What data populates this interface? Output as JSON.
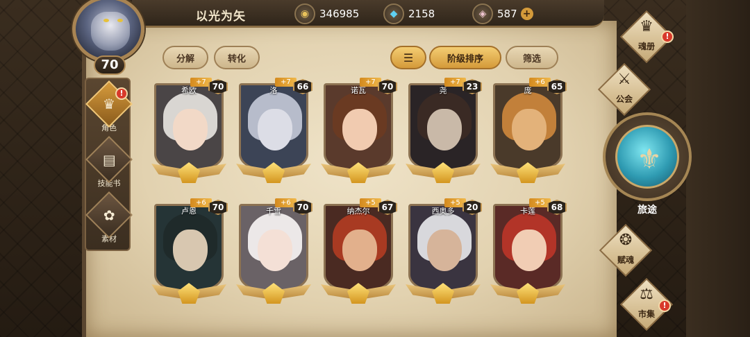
{
  "header": {
    "player_name": "以光为矢",
    "level": "70",
    "currencies": [
      {
        "icon": "gold-coin-icon",
        "value": "346985"
      },
      {
        "icon": "blue-crystal-icon",
        "value": "2158"
      },
      {
        "icon": "pink-gem-icon",
        "value": "587",
        "plus": "+"
      }
    ]
  },
  "side_tabs": [
    {
      "label": "角色",
      "icon": "helmet-icon",
      "active": true,
      "alert": "!"
    },
    {
      "label": "技能书",
      "icon": "book-icon",
      "active": false
    },
    {
      "label": "素材",
      "icon": "material-icon",
      "active": false
    }
  ],
  "actions": {
    "decompose": "分解",
    "convert": "转化",
    "sort_icon": "sort-icon",
    "rank_sort": "阶级排序",
    "filter": "筛选"
  },
  "heroes": [
    {
      "name": "希欧",
      "plus": "+7",
      "level": "70",
      "hair": "#d9d6d2",
      "skin": "#f2d9c7",
      "bg": "#4a4546"
    },
    {
      "name": "洛",
      "plus": "+7",
      "level": "66",
      "hair": "#b7bccb",
      "skin": "#dcdde6",
      "bg": "#3c4456"
    },
    {
      "name": "诺瓦",
      "plus": "+7",
      "level": "70",
      "hair": "#6a3a22",
      "skin": "#f1cbb0",
      "bg": "#5a3a2c"
    },
    {
      "name": "尧",
      "plus": "+7",
      "level": "23",
      "hair": "#3a2a24",
      "skin": "#c9b9a8",
      "bg": "#2a2426"
    },
    {
      "name": "庞",
      "plus": "+6",
      "level": "65",
      "hair": "#c2803a",
      "skin": "#e3b27a",
      "bg": "#4a3a2a"
    },
    {
      "name": "卢恩",
      "plus": "+6",
      "level": "70",
      "hair": "#1f2a2a",
      "skin": "#d8c7b0",
      "bg": "#253436"
    },
    {
      "name": "千雪",
      "plus": "+6",
      "level": "70",
      "hair": "#ece8e8",
      "skin": "#f4e0d6",
      "bg": "#6a6266"
    },
    {
      "name": "纳杰尔",
      "plus": "+5",
      "level": "67",
      "hair": "#a83a22",
      "skin": "#e2b08c",
      "bg": "#4a2a22"
    },
    {
      "name": "西奥多",
      "plus": "+5",
      "level": "20",
      "hair": "#d8d8dc",
      "skin": "#d6b49a",
      "bg": "#3a3440"
    },
    {
      "name": "卡莲",
      "plus": "+5",
      "level": "68",
      "hair": "#b23428",
      "skin": "#f1cdb4",
      "bg": "#5a2a26"
    }
  ],
  "right_nav": {
    "soul_book": "魂册",
    "guild": "公会",
    "journey": "旅途",
    "talent_soul": "赋魂",
    "market": "市集",
    "alert": "!"
  }
}
